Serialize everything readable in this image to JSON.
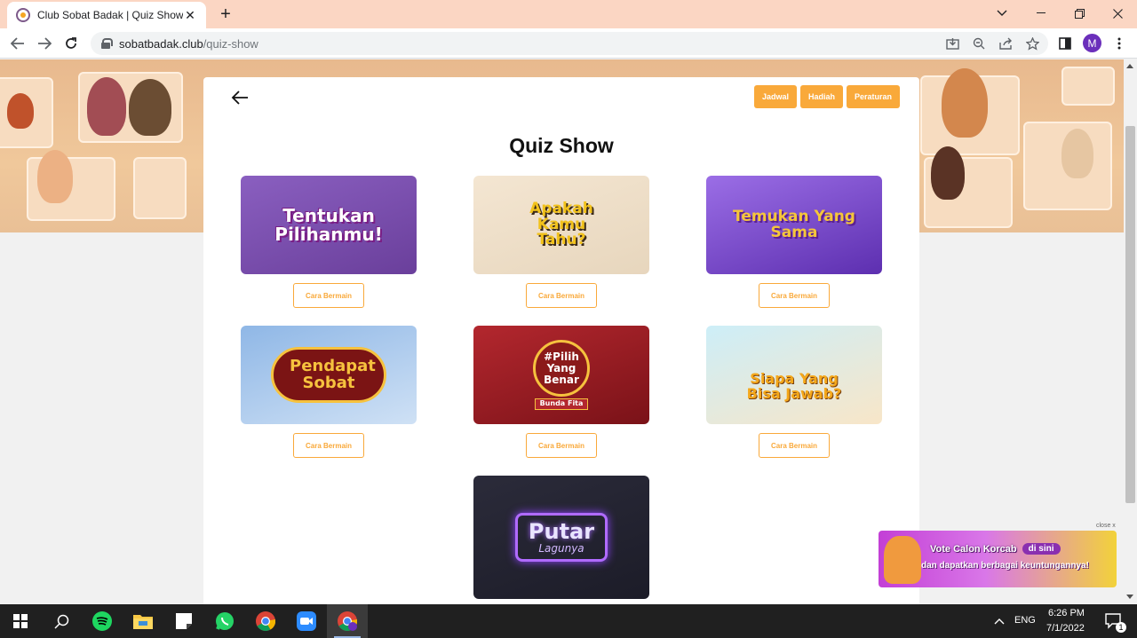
{
  "browser": {
    "tab_title": "Club Sobat Badak | Quiz Show",
    "tab_close": "✕",
    "new_tab": "+",
    "url_host": "sobatbadak.club",
    "url_path": "/quiz-show",
    "profile_initial": "M"
  },
  "page": {
    "title": "Quiz Show",
    "nav_buttons": [
      "Jadwal",
      "Hadiah",
      "Peraturan"
    ]
  },
  "games": [
    {
      "name": "Tentukan Pilihanmu!",
      "how_to": "Cara Bermain",
      "bg_from": "#8a5fc0",
      "bg_to": "#6a3f9b"
    },
    {
      "name": "Apakah Kamu Tahu?",
      "how_to": "Cara Bermain",
      "bg_from": "#f4e6d2",
      "bg_to": "#e7d6bd"
    },
    {
      "name": "Temukan Yang Sama",
      "how_to": "Cara Bermain",
      "bg_from": "#9b6ee6",
      "bg_to": "#5d2fb0"
    },
    {
      "name": "Pendapat Sobat",
      "how_to": "Cara Bermain",
      "bg_from": "#8fb7e6",
      "bg_to": "#cfe1f5"
    },
    {
      "name": "#Pilih Yang Benar",
      "sub": "Bunda Fita",
      "how_to": "Cara Bermain",
      "bg_from": "#b3272e",
      "bg_to": "#7a1218"
    },
    {
      "name": "Siapa Yang Bisa Jawab?",
      "how_to": "Cara Bermain",
      "bg_from": "#cdeef8",
      "bg_to": "#f8e6c8"
    },
    {
      "name": "Putar",
      "sub": "Lagunya",
      "bg_from": "#2b2b3a",
      "bg_to": "#1c1c28"
    }
  ],
  "promo": {
    "close": "close x",
    "line1_a": "Vote Calon Korcab",
    "line1_pill": "di sini",
    "line2": "dan dapatkan berbagai keuntungannya!"
  },
  "taskbar": {
    "apps": [
      "start-icon",
      "search-icon",
      "spotify-icon",
      "file-explorer-icon",
      "sticky-notes-icon",
      "whatsapp-icon",
      "chrome-icon",
      "zoom-icon",
      "chrome-profile-icon"
    ],
    "language": "ENG",
    "time": "6:26 PM",
    "date": "7/1/2022",
    "notification_count": "1"
  },
  "colors": {
    "accent": "#f9a93a",
    "tabbar": "#fbd6c3"
  }
}
